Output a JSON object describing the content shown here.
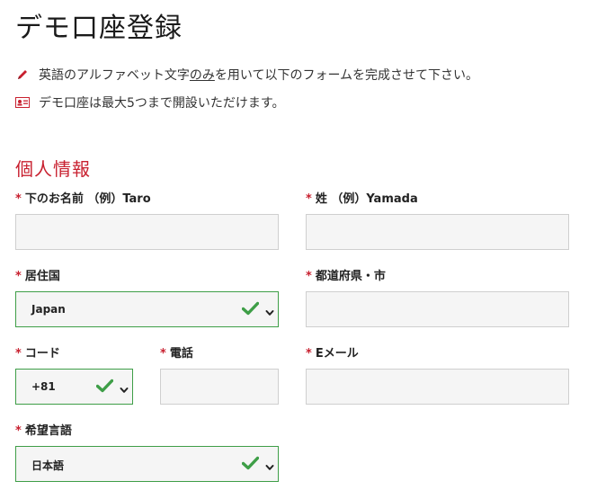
{
  "page": {
    "title": "デモ口座登録"
  },
  "notes": [
    {
      "icon": "pencil-icon",
      "pre": "英語のアルファベット文字",
      "underlined": "のみ",
      "post": "を用いて以下のフォームを完成させて下さい。"
    },
    {
      "icon": "id-card-icon",
      "text": "デモ口座は最大5つまで開設いただけます。"
    }
  ],
  "form": {
    "section_title": "個人情報",
    "required_mark": "*",
    "fields": {
      "first_name": {
        "label": "下のお名前 （例）Taro",
        "value": ""
      },
      "last_name": {
        "label": "姓 （例）Yamada",
        "value": ""
      },
      "country": {
        "label": "居住国",
        "value": "Japan"
      },
      "city": {
        "label": "都道府県・市",
        "value": ""
      },
      "code": {
        "label": "コード",
        "value": "+81"
      },
      "phone": {
        "label": "電話",
        "value": ""
      },
      "email": {
        "label": "Eメール",
        "value": ""
      },
      "language": {
        "label": "希望言語",
        "value": "日本語"
      }
    }
  },
  "colors": {
    "accent_red": "#c8202f",
    "valid_green": "#3e9e47"
  }
}
